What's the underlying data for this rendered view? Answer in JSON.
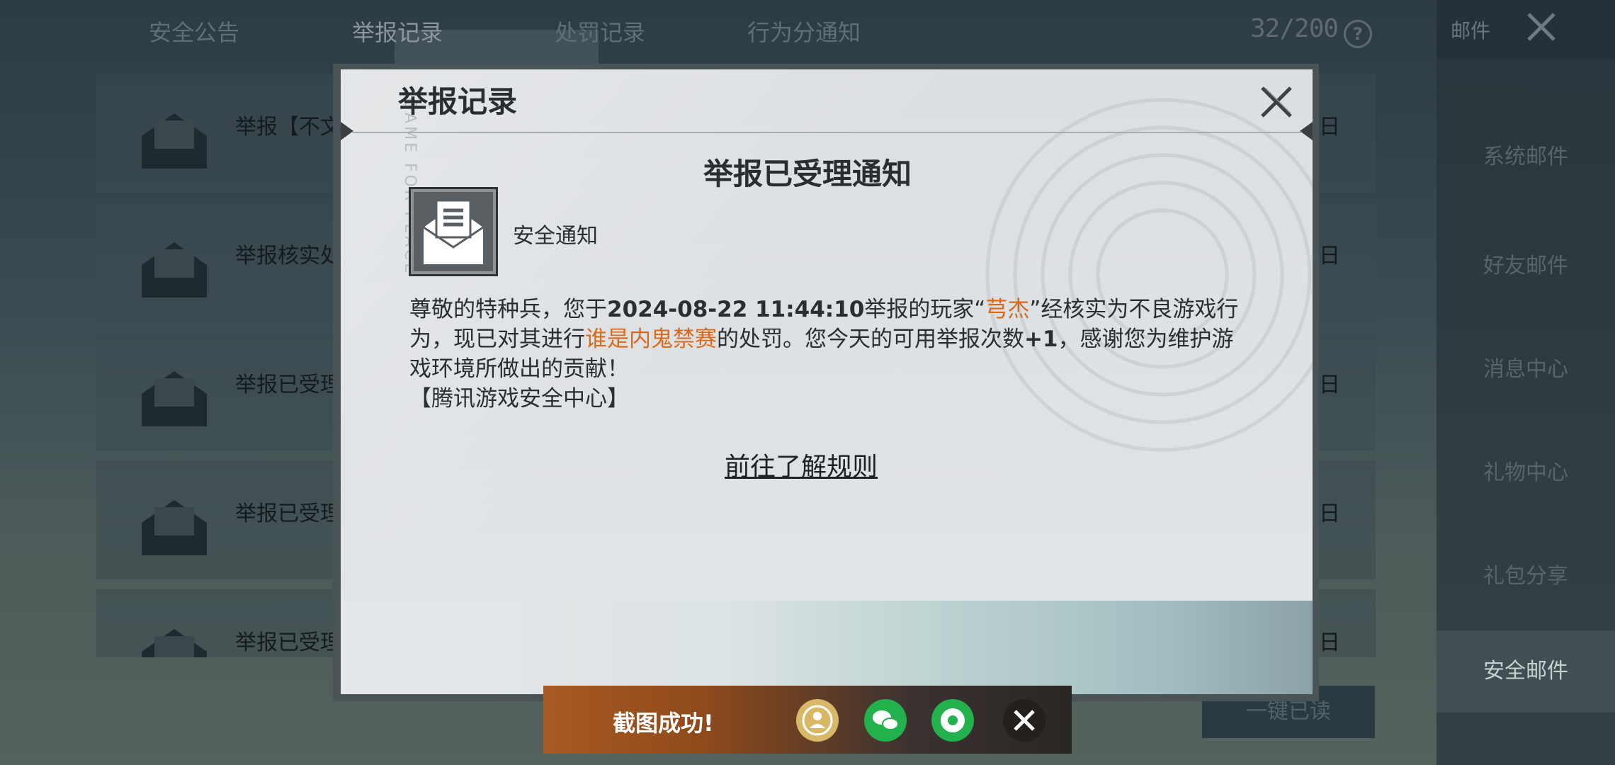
{
  "tabs": [
    {
      "label": "安全公告",
      "active": false
    },
    {
      "label": "举报记录",
      "active": true
    },
    {
      "label": "处罚记录",
      "active": false
    },
    {
      "label": "行为分通知",
      "active": false
    }
  ],
  "counter": "32/200",
  "help_icon": "?",
  "mail_header": {
    "label": "邮件"
  },
  "sidebar": [
    {
      "label": "系统邮件"
    },
    {
      "label": "好友邮件"
    },
    {
      "label": "消息中心"
    },
    {
      "label": "礼物中心"
    },
    {
      "label": "礼包分享"
    },
    {
      "label": "安全邮件",
      "active": true
    }
  ],
  "list_items": [
    {
      "text": "举报【不文",
      "date": "日"
    },
    {
      "text": "举报核实处",
      "date": "日"
    },
    {
      "text": "举报已受理",
      "date": "日"
    },
    {
      "text": "举报已受理",
      "date": "日"
    },
    {
      "text": "举报已受理",
      "date": "日"
    }
  ],
  "read_all_button": "一键已读",
  "dialog": {
    "title": "举报记录",
    "watermark": "GAME FOR PEACE",
    "notice_title": "举报已受理通知",
    "sender": "安全通知",
    "body": {
      "p1": "尊敬的特种兵，您于",
      "datetime": "2024-08-22 11:44:10",
      "p2": "举报的玩家“",
      "player": "芎杰",
      "p3": "”经核实为不良游戏行为，现已对其进行",
      "penalty": "谁是内鬼禁赛",
      "p4": "的处罚。您今天的可用举报次数",
      "plus": "+1",
      "p5": "，感谢您为维护游戏环境所做出的贡献！",
      "signature": "【腾讯游戏安全中心】"
    },
    "rules_link": "前往了解规则"
  },
  "screenshot_bar": {
    "text": "截图成功!",
    "icons": [
      "qq-icon",
      "wechat-icon",
      "moments-icon",
      "close-icon"
    ]
  },
  "colors": {
    "highlight": "#d86a1c",
    "dialog_bg": "#dfe2e5",
    "screenshot_bar": "#a85a21"
  }
}
